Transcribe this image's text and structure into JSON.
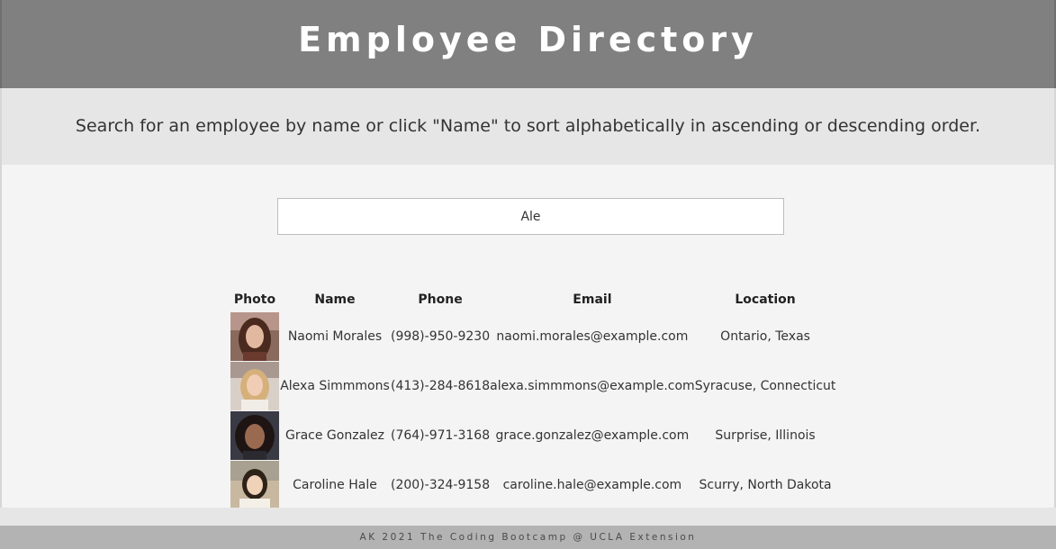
{
  "header": {
    "title": "Employee Directory"
  },
  "subheader": {
    "text": "Search for an employee by name or click \"Name\" to sort alphabetically in ascending or descending order."
  },
  "search": {
    "value": "Ale"
  },
  "table": {
    "headers": {
      "photo": "Photo",
      "name": "Name",
      "phone": "Phone",
      "email": "Email",
      "location": "Location"
    },
    "rows": [
      {
        "name": "Naomi Morales",
        "phone": "(998)-950-9230",
        "email": "naomi.morales@example.com",
        "location": "Ontario, Texas"
      },
      {
        "name": "Alexa Simmmons",
        "phone": "(413)-284-8618",
        "email": "alexa.simmmons@example.com",
        "location": "Syracuse, Connecticut"
      },
      {
        "name": "Grace Gonzalez",
        "phone": "(764)-971-3168",
        "email": "grace.gonzalez@example.com",
        "location": "Surprise, Illinois"
      },
      {
        "name": "Caroline Hale",
        "phone": "(200)-324-9158",
        "email": "caroline.hale@example.com",
        "location": "Scurry, North Dakota"
      }
    ]
  },
  "footer": {
    "text": "AK 2021 The Coding Bootcamp @ UCLA Extension"
  }
}
